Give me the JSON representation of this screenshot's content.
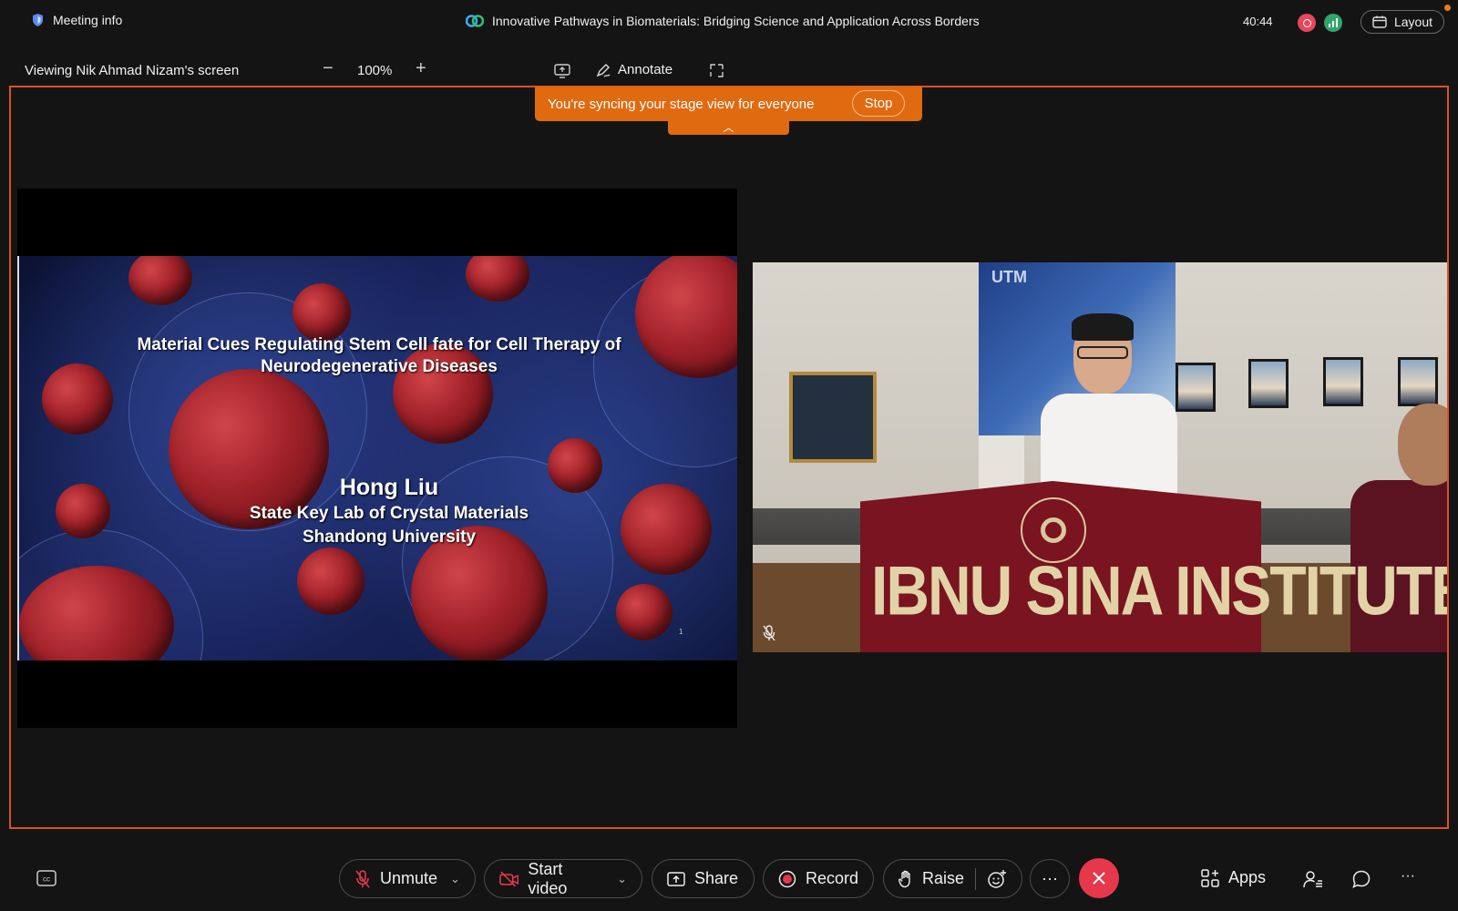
{
  "top_bar": {
    "meeting_info_label": "Meeting info",
    "meeting_title": "Innovative Pathways in Biomaterials: Bridging Science and Application Across Borders",
    "timer": "40:44",
    "layout_label": "Layout"
  },
  "share_bar": {
    "viewing_label": "Viewing Nik Ahmad Nizam's screen",
    "zoom_level": "100%",
    "zoom_out_symbol": "−",
    "zoom_in_symbol": "+",
    "annotate_label": "Annotate"
  },
  "sync_banner": {
    "message": "You're syncing your stage view for everyone",
    "stop_label": "Stop",
    "collapse_symbol": "︿"
  },
  "slide": {
    "title_line1": "Material Cues Regulating Stem Cell fate for Cell Therapy of",
    "title_line2": "Neurodegenerative Diseases",
    "author": "Hong Liu",
    "affiliation_line1": "State Key Lab of Crystal Materials",
    "affiliation_line2": "Shandong University",
    "page_number": "1"
  },
  "video": {
    "banner_text": "UTM",
    "podium_text": "IBNU SINA INSTITUTE",
    "muted": true
  },
  "controls": {
    "unmute_label": "Unmute",
    "start_video_label": "Start video",
    "share_label": "Share",
    "record_label": "Record",
    "raise_label": "Raise",
    "more_symbol": "···",
    "apps_label": "Apps",
    "overflow_symbol": "···"
  },
  "colors": {
    "accent_orange": "#e06a10",
    "stage_border": "#d8541c",
    "leave_red": "#e5384a",
    "record_red": "#e5485d",
    "network_green": "#2fa56a"
  },
  "icons": [
    "shield-icon",
    "webex-logo-icon",
    "record-indicator-icon",
    "network-icon",
    "calendar-layout-icon",
    "share-screen-icon",
    "annotate-pen-icon",
    "fullscreen-icon",
    "closed-caption-icon",
    "mic-muted-icon",
    "camera-off-icon",
    "share-up-icon",
    "record-icon",
    "hand-icon",
    "reaction-icon",
    "close-icon",
    "apps-grid-icon",
    "participants-icon",
    "chat-icon"
  ]
}
